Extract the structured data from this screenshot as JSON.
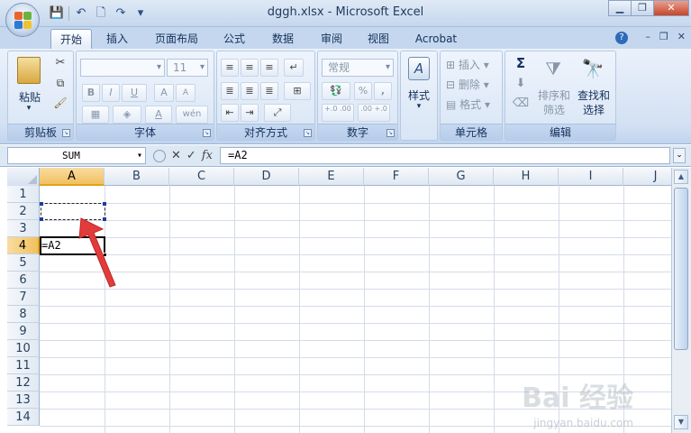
{
  "window": {
    "title": "dggh.xlsx - Microsoft Excel",
    "minimize_label": "▁",
    "restore_label": "❐",
    "close_label": "✕"
  },
  "ribbon_tabs": [
    "开始",
    "插入",
    "页面布局",
    "公式",
    "数据",
    "审阅",
    "视图",
    "Acrobat"
  ],
  "active_tab": "开始",
  "ribbon": {
    "clipboard": {
      "paste_label": "粘贴",
      "group_label": "剪贴板"
    },
    "font": {
      "font_name": "",
      "font_size": "11",
      "group_label": "字体",
      "bold": "B",
      "italic": "I",
      "underline": "U",
      "grow": "A",
      "shrink": "A",
      "font_color": "A",
      "phonetic": "wén"
    },
    "alignment": {
      "group_label": "对齐方式"
    },
    "number": {
      "format": "常规",
      "percent": "%",
      "comma": ",",
      "inc_decimal": "+.0 .00",
      "dec_decimal": ".00 +.0",
      "group_label": "数字"
    },
    "styles": {
      "label": "样式"
    },
    "cells": {
      "insert": "插入",
      "delete": "删除",
      "format": "格式",
      "group_label": "单元格"
    },
    "editing": {
      "sigma": "Σ",
      "sort_filter_1": "排序和",
      "sort_filter_2": "筛选",
      "find_select_1": "查找和",
      "find_select_2": "选择",
      "group_label": "编辑"
    }
  },
  "formula_bar": {
    "name_box": "SUM",
    "cancel": "✕",
    "enter": "✓",
    "fx": "fx",
    "content": "=A2"
  },
  "columns": [
    "A",
    "B",
    "C",
    "D",
    "E",
    "F",
    "G",
    "H",
    "I",
    "J"
  ],
  "selected_column": "A",
  "rows": [
    "1",
    "2",
    "3",
    "4",
    "5",
    "6",
    "7",
    "8",
    "9",
    "10",
    "11",
    "12",
    "13",
    "14"
  ],
  "selected_row": "4",
  "cells": {
    "A4": "=A2"
  },
  "marquee_cell": "A2",
  "active_cell": "A4",
  "watermark": {
    "main": "Bai 经验",
    "sub": "jingyan.baidu.com"
  },
  "colors": {
    "annotation_arrow": "#e23b3b",
    "selection_header": "#f1c15f"
  }
}
